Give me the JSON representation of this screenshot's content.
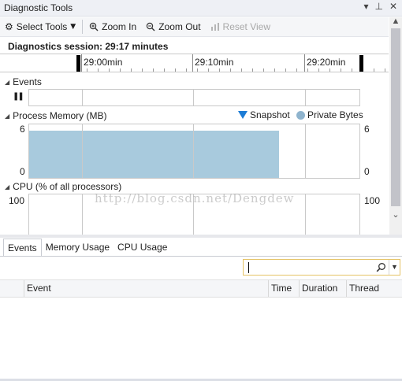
{
  "window": {
    "title": "Diagnostic Tools",
    "buttons": {
      "dropdown": "▾",
      "pin": "⊥",
      "close": "✕"
    }
  },
  "toolbar": {
    "select_tools_label": "Select Tools",
    "zoom_in_label": "Zoom In",
    "zoom_out_label": "Zoom Out",
    "reset_view_label": "Reset View"
  },
  "session": {
    "label": "Diagnostics session: 29:17 minutes"
  },
  "timeline": {
    "ticks": [
      "29:00min",
      "29:10min",
      "29:20min"
    ]
  },
  "events_section": {
    "title": "Events",
    "pause_glyph": "❚❚"
  },
  "memory_section": {
    "title": "Process Memory (MB)",
    "legend": {
      "snapshot": "Snapshot",
      "private_bytes": "Private Bytes"
    },
    "axis_left": {
      "max": "6",
      "min": "0"
    },
    "axis_right": {
      "max": "6",
      "min": "0"
    },
    "private_bytes_value": 6,
    "axis_max_value": 6
  },
  "cpu_section": {
    "title": "CPU (% of all processors)",
    "axis_left_max": "100",
    "axis_right_max": "100"
  },
  "watermark": "http://blog.csdn.net/Dengdew",
  "tabs": [
    {
      "label": "Events",
      "active": true
    },
    {
      "label": "Memory Usage",
      "active": false
    },
    {
      "label": "CPU Usage",
      "active": false
    }
  ],
  "table": {
    "columns": [
      "Event",
      "Time",
      "Duration",
      "Thread"
    ]
  },
  "colors": {
    "memory_fill": "#a8cadd",
    "snapshot_marker": "#1c7cd5",
    "private_bytes_marker": "#8fb4ce",
    "search_border": "#e5c365"
  }
}
